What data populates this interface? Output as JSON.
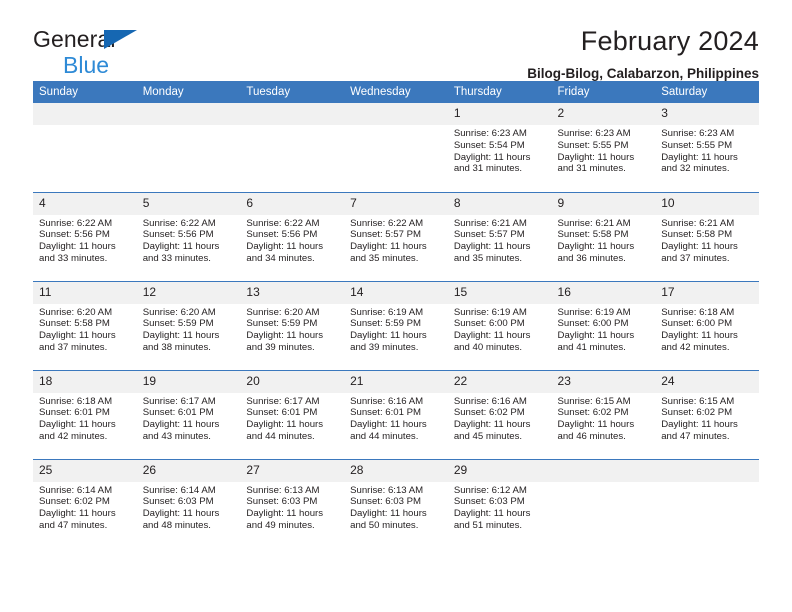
{
  "brand": {
    "line1": "General",
    "line2": "Blue",
    "triangle_color": "#1667b2",
    "blue_text_color": "#2e8ad6"
  },
  "header": {
    "title": "February 2024",
    "subtitle": "Bilog-Bilog, Calabarzon, Philippines"
  },
  "theme": {
    "accent": "#3b78bd",
    "daynum_bg": "#f1f1f1",
    "text": "#231f20"
  },
  "weekdays": [
    "Sunday",
    "Monday",
    "Tuesday",
    "Wednesday",
    "Thursday",
    "Friday",
    "Saturday"
  ],
  "weeks": [
    [
      {
        "day": "",
        "sunrise": "",
        "sunset": "",
        "daylight1": "",
        "daylight2": ""
      },
      {
        "day": "",
        "sunrise": "",
        "sunset": "",
        "daylight1": "",
        "daylight2": ""
      },
      {
        "day": "",
        "sunrise": "",
        "sunset": "",
        "daylight1": "",
        "daylight2": ""
      },
      {
        "day": "",
        "sunrise": "",
        "sunset": "",
        "daylight1": "",
        "daylight2": ""
      },
      {
        "day": "1",
        "sunrise": "Sunrise: 6:23 AM",
        "sunset": "Sunset: 5:54 PM",
        "daylight1": "Daylight: 11 hours",
        "daylight2": "and 31 minutes."
      },
      {
        "day": "2",
        "sunrise": "Sunrise: 6:23 AM",
        "sunset": "Sunset: 5:55 PM",
        "daylight1": "Daylight: 11 hours",
        "daylight2": "and 31 minutes."
      },
      {
        "day": "3",
        "sunrise": "Sunrise: 6:23 AM",
        "sunset": "Sunset: 5:55 PM",
        "daylight1": "Daylight: 11 hours",
        "daylight2": "and 32 minutes."
      }
    ],
    [
      {
        "day": "4",
        "sunrise": "Sunrise: 6:22 AM",
        "sunset": "Sunset: 5:56 PM",
        "daylight1": "Daylight: 11 hours",
        "daylight2": "and 33 minutes."
      },
      {
        "day": "5",
        "sunrise": "Sunrise: 6:22 AM",
        "sunset": "Sunset: 5:56 PM",
        "daylight1": "Daylight: 11 hours",
        "daylight2": "and 33 minutes."
      },
      {
        "day": "6",
        "sunrise": "Sunrise: 6:22 AM",
        "sunset": "Sunset: 5:56 PM",
        "daylight1": "Daylight: 11 hours",
        "daylight2": "and 34 minutes."
      },
      {
        "day": "7",
        "sunrise": "Sunrise: 6:22 AM",
        "sunset": "Sunset: 5:57 PM",
        "daylight1": "Daylight: 11 hours",
        "daylight2": "and 35 minutes."
      },
      {
        "day": "8",
        "sunrise": "Sunrise: 6:21 AM",
        "sunset": "Sunset: 5:57 PM",
        "daylight1": "Daylight: 11 hours",
        "daylight2": "and 35 minutes."
      },
      {
        "day": "9",
        "sunrise": "Sunrise: 6:21 AM",
        "sunset": "Sunset: 5:58 PM",
        "daylight1": "Daylight: 11 hours",
        "daylight2": "and 36 minutes."
      },
      {
        "day": "10",
        "sunrise": "Sunrise: 6:21 AM",
        "sunset": "Sunset: 5:58 PM",
        "daylight1": "Daylight: 11 hours",
        "daylight2": "and 37 minutes."
      }
    ],
    [
      {
        "day": "11",
        "sunrise": "Sunrise: 6:20 AM",
        "sunset": "Sunset: 5:58 PM",
        "daylight1": "Daylight: 11 hours",
        "daylight2": "and 37 minutes."
      },
      {
        "day": "12",
        "sunrise": "Sunrise: 6:20 AM",
        "sunset": "Sunset: 5:59 PM",
        "daylight1": "Daylight: 11 hours",
        "daylight2": "and 38 minutes."
      },
      {
        "day": "13",
        "sunrise": "Sunrise: 6:20 AM",
        "sunset": "Sunset: 5:59 PM",
        "daylight1": "Daylight: 11 hours",
        "daylight2": "and 39 minutes."
      },
      {
        "day": "14",
        "sunrise": "Sunrise: 6:19 AM",
        "sunset": "Sunset: 5:59 PM",
        "daylight1": "Daylight: 11 hours",
        "daylight2": "and 39 minutes."
      },
      {
        "day": "15",
        "sunrise": "Sunrise: 6:19 AM",
        "sunset": "Sunset: 6:00 PM",
        "daylight1": "Daylight: 11 hours",
        "daylight2": "and 40 minutes."
      },
      {
        "day": "16",
        "sunrise": "Sunrise: 6:19 AM",
        "sunset": "Sunset: 6:00 PM",
        "daylight1": "Daylight: 11 hours",
        "daylight2": "and 41 minutes."
      },
      {
        "day": "17",
        "sunrise": "Sunrise: 6:18 AM",
        "sunset": "Sunset: 6:00 PM",
        "daylight1": "Daylight: 11 hours",
        "daylight2": "and 42 minutes."
      }
    ],
    [
      {
        "day": "18",
        "sunrise": "Sunrise: 6:18 AM",
        "sunset": "Sunset: 6:01 PM",
        "daylight1": "Daylight: 11 hours",
        "daylight2": "and 42 minutes."
      },
      {
        "day": "19",
        "sunrise": "Sunrise: 6:17 AM",
        "sunset": "Sunset: 6:01 PM",
        "daylight1": "Daylight: 11 hours",
        "daylight2": "and 43 minutes."
      },
      {
        "day": "20",
        "sunrise": "Sunrise: 6:17 AM",
        "sunset": "Sunset: 6:01 PM",
        "daylight1": "Daylight: 11 hours",
        "daylight2": "and 44 minutes."
      },
      {
        "day": "21",
        "sunrise": "Sunrise: 6:16 AM",
        "sunset": "Sunset: 6:01 PM",
        "daylight1": "Daylight: 11 hours",
        "daylight2": "and 44 minutes."
      },
      {
        "day": "22",
        "sunrise": "Sunrise: 6:16 AM",
        "sunset": "Sunset: 6:02 PM",
        "daylight1": "Daylight: 11 hours",
        "daylight2": "and 45 minutes."
      },
      {
        "day": "23",
        "sunrise": "Sunrise: 6:15 AM",
        "sunset": "Sunset: 6:02 PM",
        "daylight1": "Daylight: 11 hours",
        "daylight2": "and 46 minutes."
      },
      {
        "day": "24",
        "sunrise": "Sunrise: 6:15 AM",
        "sunset": "Sunset: 6:02 PM",
        "daylight1": "Daylight: 11 hours",
        "daylight2": "and 47 minutes."
      }
    ],
    [
      {
        "day": "25",
        "sunrise": "Sunrise: 6:14 AM",
        "sunset": "Sunset: 6:02 PM",
        "daylight1": "Daylight: 11 hours",
        "daylight2": "and 47 minutes."
      },
      {
        "day": "26",
        "sunrise": "Sunrise: 6:14 AM",
        "sunset": "Sunset: 6:03 PM",
        "daylight1": "Daylight: 11 hours",
        "daylight2": "and 48 minutes."
      },
      {
        "day": "27",
        "sunrise": "Sunrise: 6:13 AM",
        "sunset": "Sunset: 6:03 PM",
        "daylight1": "Daylight: 11 hours",
        "daylight2": "and 49 minutes."
      },
      {
        "day": "28",
        "sunrise": "Sunrise: 6:13 AM",
        "sunset": "Sunset: 6:03 PM",
        "daylight1": "Daylight: 11 hours",
        "daylight2": "and 50 minutes."
      },
      {
        "day": "29",
        "sunrise": "Sunrise: 6:12 AM",
        "sunset": "Sunset: 6:03 PM",
        "daylight1": "Daylight: 11 hours",
        "daylight2": "and 51 minutes."
      },
      {
        "day": "",
        "sunrise": "",
        "sunset": "",
        "daylight1": "",
        "daylight2": ""
      },
      {
        "day": "",
        "sunrise": "",
        "sunset": "",
        "daylight1": "",
        "daylight2": ""
      }
    ]
  ]
}
